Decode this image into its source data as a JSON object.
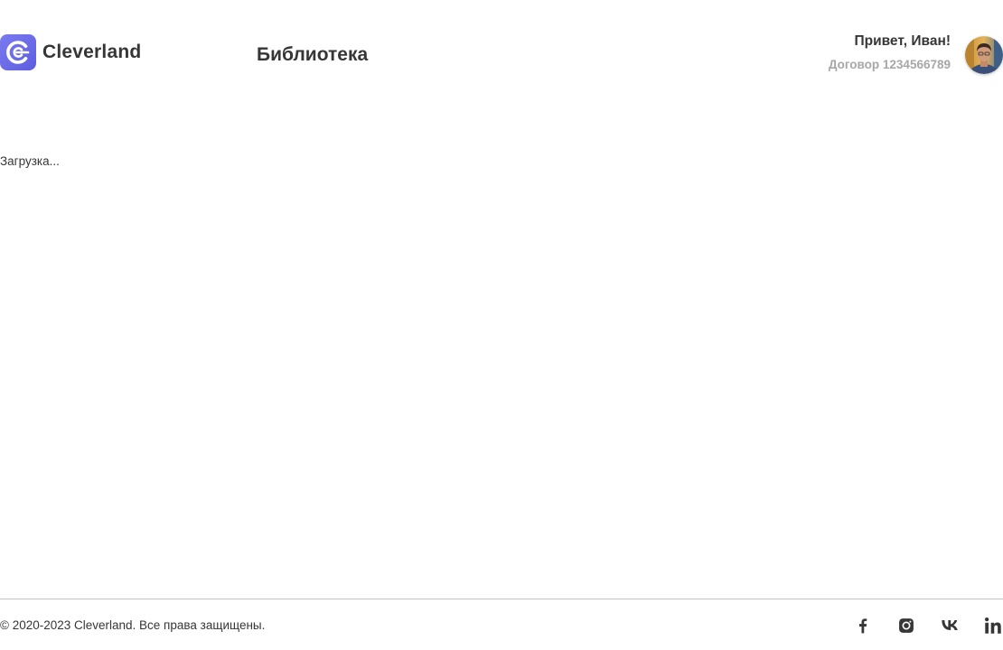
{
  "header": {
    "logo_text": "Cleverland",
    "page_title": "Библиотека",
    "user": {
      "greeting": "Привет, Иван!",
      "contract": "Договор 1234566789"
    }
  },
  "main": {
    "loading_text": "Загрузка..."
  },
  "footer": {
    "copyright": "© 2020-2023 Cleverland. Все права защищены.",
    "social_links": [
      "facebook-icon",
      "instagram-icon",
      "vk-icon",
      "linkedin-icon"
    ]
  },
  "colors": {
    "brand": "#6E6CEB",
    "text": "#363636",
    "muted": "#A7A7A7",
    "divider": "#BFC4C9"
  }
}
